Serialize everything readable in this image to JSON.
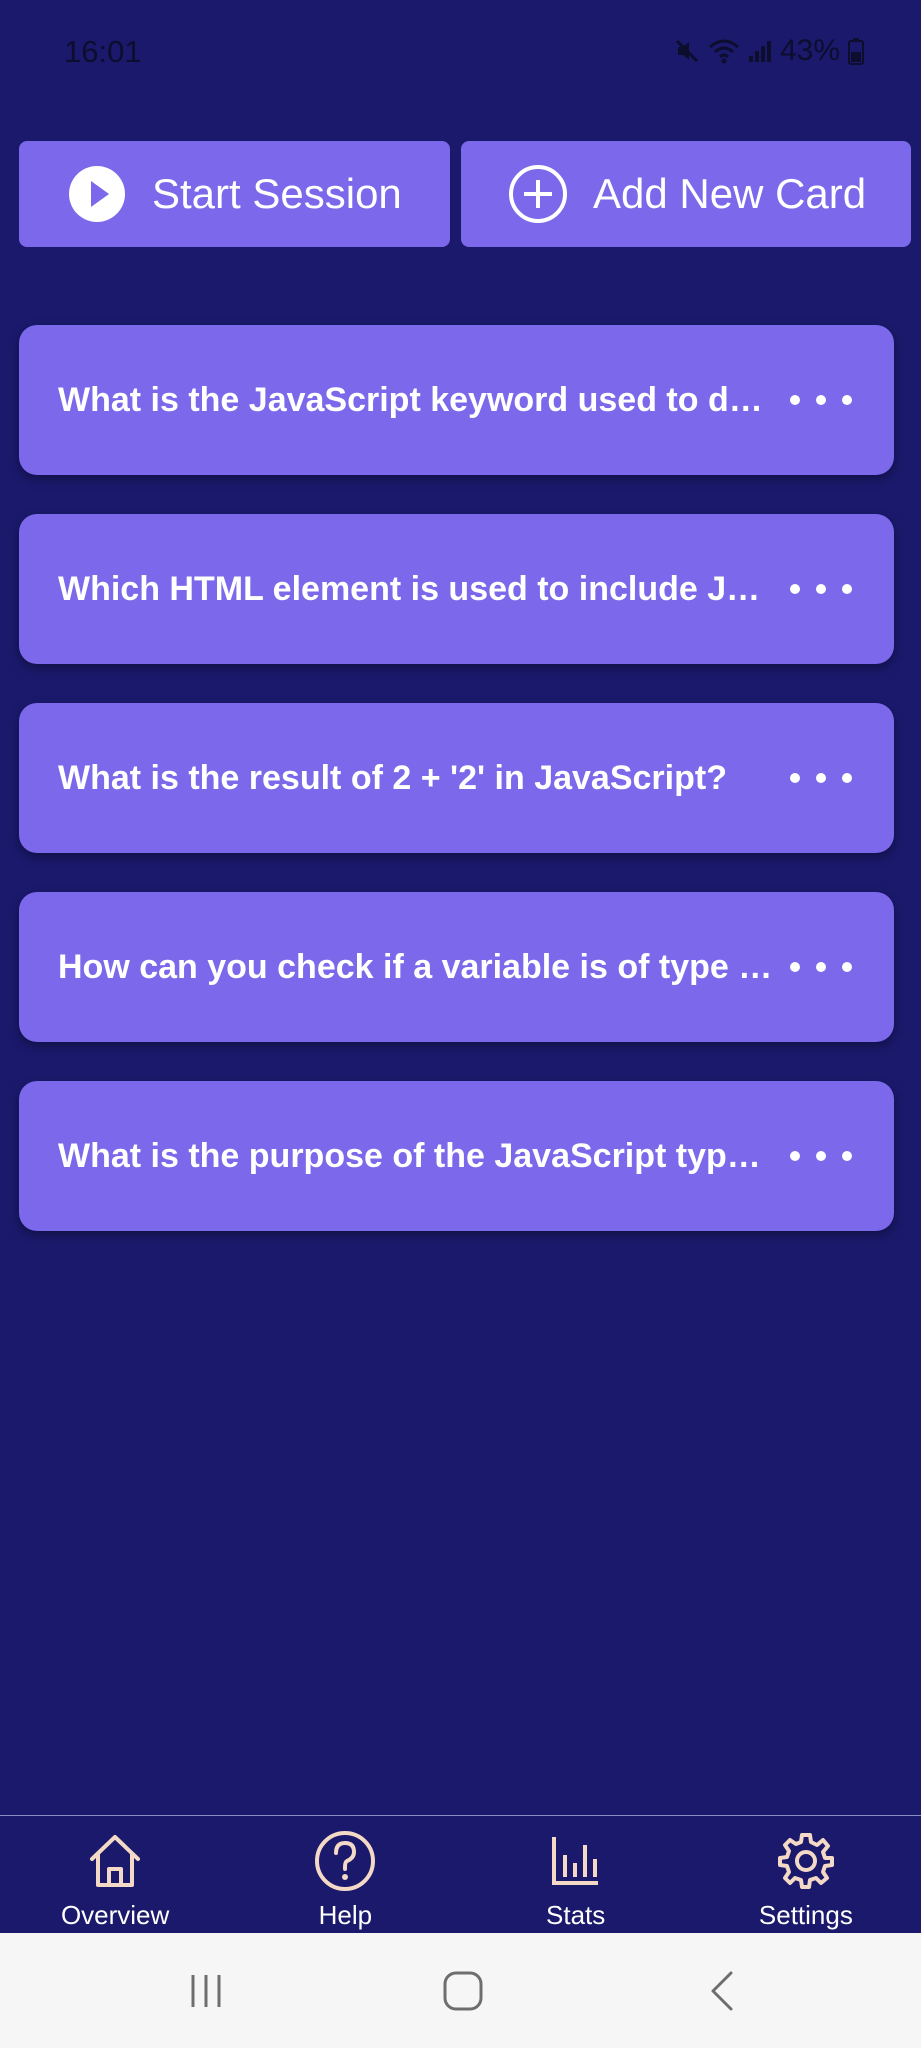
{
  "status_bar": {
    "time": "16:01",
    "battery": "43%",
    "icons": [
      "mute-icon",
      "wifi-icon",
      "signal-icon",
      "battery-icon"
    ]
  },
  "actions": {
    "start_session": {
      "label": "Start Session",
      "icon": "play-circle-icon"
    },
    "add_card": {
      "label": "Add New Card",
      "icon": "plus-circle-icon"
    }
  },
  "cards": [
    {
      "question": "What is the JavaScript keyword used to declare a variable?"
    },
    {
      "question": "Which HTML element is used to include JavaScript code?"
    },
    {
      "question": "What is the result of 2 + '2' in JavaScript?"
    },
    {
      "question": "How can you check if a variable is of type array?"
    },
    {
      "question": "What is the purpose of the JavaScript typeof operator?"
    }
  ],
  "bottom_nav": [
    {
      "label": "Overview",
      "icon": "home-icon"
    },
    {
      "label": "Help",
      "icon": "help-icon"
    },
    {
      "label": "Stats",
      "icon": "stats-icon"
    },
    {
      "label": "Settings",
      "icon": "settings-icon"
    }
  ],
  "system_nav": [
    "recent-apps-icon",
    "home-button-icon",
    "back-icon"
  ],
  "colors": {
    "background": "#1a196c",
    "accent": "#7b68ea",
    "icon_tint": "#f4d9c6",
    "text": "#ffffff"
  }
}
